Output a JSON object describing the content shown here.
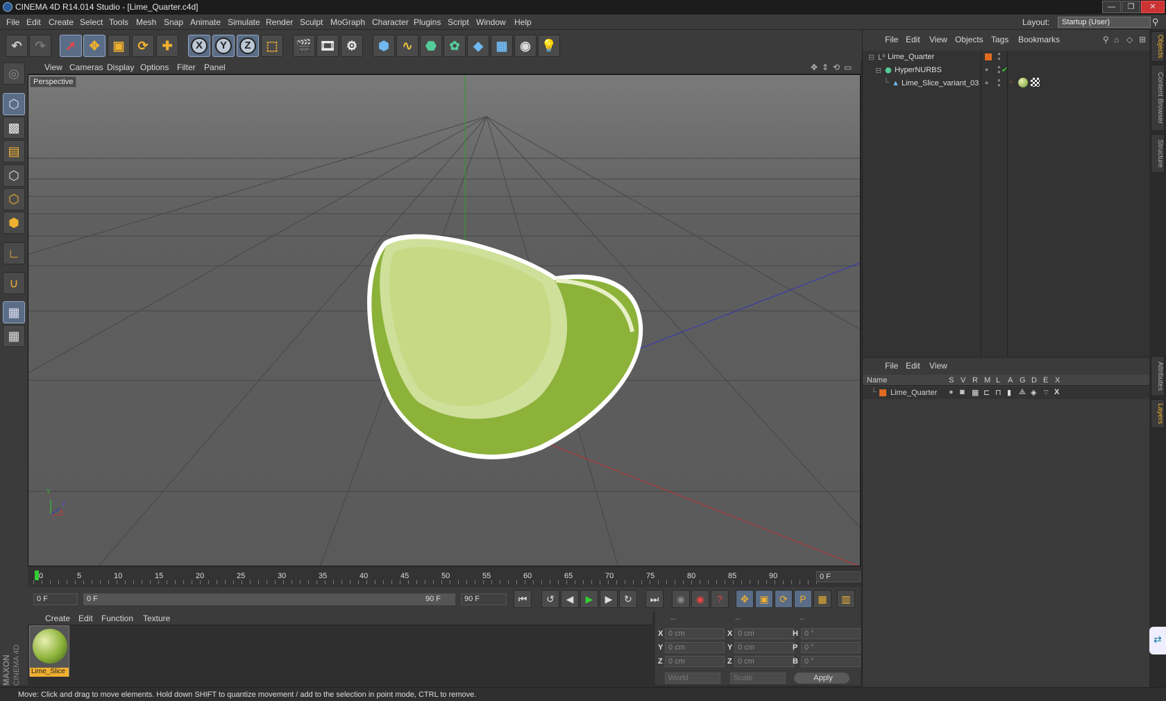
{
  "window": {
    "title": "CINEMA 4D R14.014 Studio - [Lime_Quarter.c4d]",
    "controls": [
      "—",
      "❐",
      "✕"
    ]
  },
  "menubar": {
    "items": [
      "File",
      "Edit",
      "Create",
      "Select",
      "Tools",
      "Mesh",
      "Snap",
      "Animate",
      "Simulate",
      "Render",
      "Sculpt",
      "MoGraph",
      "Character",
      "Plugins",
      "Script",
      "Window",
      "Help"
    ],
    "layout_label": "Layout:",
    "layout_value": "Startup (User)"
  },
  "viewport": {
    "menu": [
      "View",
      "Cameras",
      "Display",
      "Options",
      "Filter",
      "Panel"
    ],
    "camera_label": "Perspective",
    "axis_labels": {
      "y": "Y",
      "z": "Z",
      "x": "X"
    }
  },
  "timeline": {
    "ticks": [
      "0",
      "5",
      "10",
      "15",
      "20",
      "25",
      "30",
      "35",
      "40",
      "45",
      "50",
      "55",
      "60",
      "65",
      "70",
      "75",
      "80",
      "85",
      "90"
    ],
    "current_frame": "0 F",
    "start_field": "0 F",
    "range_start": "0 F",
    "range_end": "90 F",
    "end_field": "90 F"
  },
  "material_manager": {
    "menu": [
      "Create",
      "Edit",
      "Function",
      "Texture"
    ],
    "material_name": "Lime_Slice"
  },
  "coordinates": {
    "headers": [
      "--",
      "--",
      "--"
    ],
    "rows": [
      {
        "a": "X",
        "av": "0 cm",
        "b": "X",
        "bv": "0 cm",
        "c": "H",
        "cv": "0 °"
      },
      {
        "a": "Y",
        "av": "0 cm",
        "b": "Y",
        "bv": "0 cm",
        "c": "P",
        "cv": "0 °"
      },
      {
        "a": "Z",
        "av": "0 cm",
        "b": "Z",
        "bv": "0 cm",
        "c": "B",
        "cv": "0 °"
      }
    ],
    "world_select": "World",
    "scale_select": "Scale",
    "apply_label": "Apply"
  },
  "object_manager": {
    "menu": [
      "File",
      "Edit",
      "View",
      "Objects",
      "Tags",
      "Bookmarks"
    ],
    "objects": [
      {
        "name": "Lime_Quarter",
        "level": 0
      },
      {
        "name": "HyperNURBS",
        "level": 1
      },
      {
        "name": "Lime_Slice_variant_03",
        "level": 2
      }
    ]
  },
  "layer_manager": {
    "menu": [
      "File",
      "Edit",
      "View"
    ],
    "columns": [
      "Name",
      "S",
      "V",
      "R",
      "M",
      "L",
      "A",
      "G",
      "D",
      "E",
      "X"
    ],
    "layers": [
      {
        "name": "Lime_Quarter",
        "color": "#e06a20"
      }
    ]
  },
  "right_tabs": [
    "Objects",
    "Content Browser",
    "Structure",
    "Attributes",
    "Layers"
  ],
  "status": "Move: Click and drag to move elements. Hold down SHIFT to quantize movement / add to the selection in point mode, CTRL to remove.",
  "brand": {
    "maxon": "MAXON",
    "product": "CINEMA 4D"
  },
  "colors": {
    "accent": "#f0b030",
    "selection": "#5b6d86",
    "layer": "#e06a20"
  }
}
